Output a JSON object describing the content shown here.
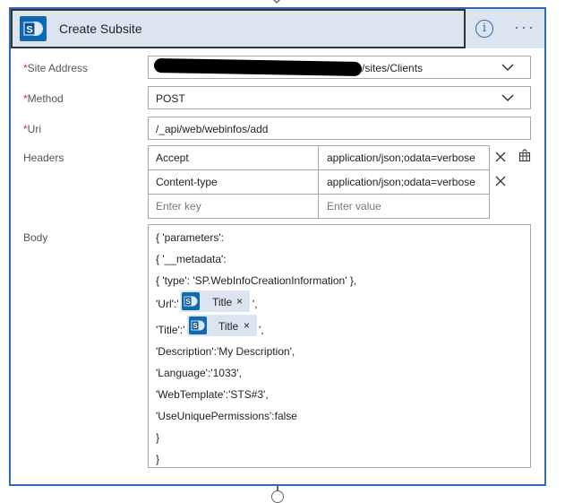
{
  "card": {
    "title": "Create Subsite",
    "info_icon_glyph": "i",
    "more_icon_glyph": "···",
    "accent_color": "#2e6db4",
    "sp_icon_color": "#0f6ab4"
  },
  "fields": {
    "site_address": {
      "label": "Site Address",
      "required_mark": "*",
      "value": "/sites/Clients"
    },
    "method": {
      "label": "Method",
      "required_mark": "*",
      "value": "POST"
    },
    "uri": {
      "label": "Uri",
      "required_mark": "*",
      "value": "/_api/web/webinfos/add"
    },
    "headers": {
      "label": "Headers",
      "rows": [
        {
          "key": "Accept",
          "value": "application/json;odata=verbose"
        },
        {
          "key": "Content-type",
          "value": "application/json;odata=verbose"
        }
      ],
      "key_placeholder": "Enter key",
      "value_placeholder": "Enter value"
    },
    "body": {
      "label": "Body",
      "lines": [
        "{ 'parameters':",
        "{ '__metadata':",
        "{ 'type': 'SP.WebInfoCreationInformation' },",
        "'Url':'",
        "'Title':'",
        "'Description':'My Description',",
        "'Language':'1033',",
        "'WebTemplate':'STS#3',",
        "'UseUniquePermissions':false",
        "}",
        "}"
      ],
      "url_suffix": "',",
      "title_suffix": "',",
      "tokens": [
        {
          "label": "Title",
          "close": "×"
        },
        {
          "label": "Title",
          "close": "×"
        }
      ]
    }
  }
}
